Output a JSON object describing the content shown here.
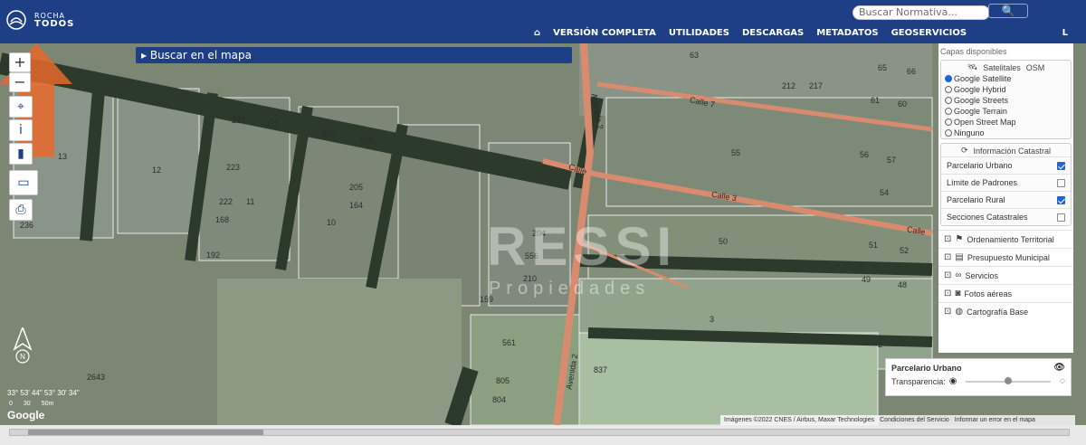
{
  "header": {
    "logo_top": "ROCHA",
    "logo_bottom": "TODOS",
    "search_placeholder": "Buscar Normativa...",
    "search_button": "🔍"
  },
  "menu": {
    "home_icon": "home-icon",
    "items": [
      {
        "label": "VERSIÓN COMPLETA"
      },
      {
        "label": "UTILIDADES"
      },
      {
        "label": "DESCARGAS"
      },
      {
        "label": "METADATOS"
      },
      {
        "label": "GEOSERVICIOS"
      }
    ],
    "caret": "L"
  },
  "map": {
    "search_label": "▸ Buscar en el mapa",
    "zoom_in": "+",
    "zoom_out": "−",
    "tools": [
      "location-pin-icon",
      "info-icon",
      "bookmark-icon",
      "screen-icon",
      "print-icon"
    ],
    "parcel_labels": [
      "13",
      "12",
      "231",
      "177",
      "232",
      "163",
      "223",
      "222",
      "11",
      "168",
      "10",
      "205",
      "164",
      "236",
      "192",
      "204",
      "556",
      "210",
      "159",
      "561",
      "805",
      "804",
      "2643",
      "63",
      "212",
      "217",
      "65",
      "66",
      "61",
      "60",
      "55",
      "56",
      "57",
      "54",
      "50",
      "51",
      "52",
      "49",
      "48",
      "3",
      "837",
      "2"
    ],
    "streets": [
      "Calle 7",
      "Calle",
      "Calle 3",
      "Calle",
      "Avenida 2",
      "Avenida 2"
    ],
    "watermark_main": "RESSI",
    "watermark_sub": "Propiedades",
    "coords": "33° 53' 44\"  53° 30' 34\"",
    "scale_labels": [
      "0",
      "30",
      "50m"
    ],
    "google": "Google",
    "attribution": [
      "Imágenes ©2022 CNES / Airbus, Maxar Technologies",
      "Condiciones del Servicio",
      "Informar un error en el mapa"
    ]
  },
  "panel": {
    "title": "Capas disponibles",
    "base_layers_title": "Satelitales",
    "osm_label": "OSM",
    "base_layers": [
      {
        "label": "Google Satellite",
        "selected": true
      },
      {
        "label": "Google Hybrid",
        "selected": false
      },
      {
        "label": "Google Streets",
        "selected": false
      },
      {
        "label": "Google Terrain",
        "selected": false
      },
      {
        "label": "Open Street Map",
        "selected": false
      },
      {
        "label": "Ninguno",
        "selected": false
      }
    ],
    "cadastral_title": "Información Catastral",
    "cadastral": [
      {
        "label": "Parcelario Urbano",
        "checked": true
      },
      {
        "label": "Límite de Padrones",
        "checked": false
      },
      {
        "label": "Parcelario Rural",
        "checked": true
      },
      {
        "label": "Secciones Catastrales",
        "checked": false
      }
    ],
    "sections": [
      {
        "label": "Ordenamiento Territorial"
      },
      {
        "label": "Presupuesto Municipal"
      },
      {
        "label": "Servicios"
      },
      {
        "label": "Fotos aéreas"
      },
      {
        "label": "Cartografía Base"
      }
    ]
  },
  "popup": {
    "title": "Parcelario Urbano",
    "transparency_label": "Transparencia:",
    "transparency_value": 0.5
  }
}
